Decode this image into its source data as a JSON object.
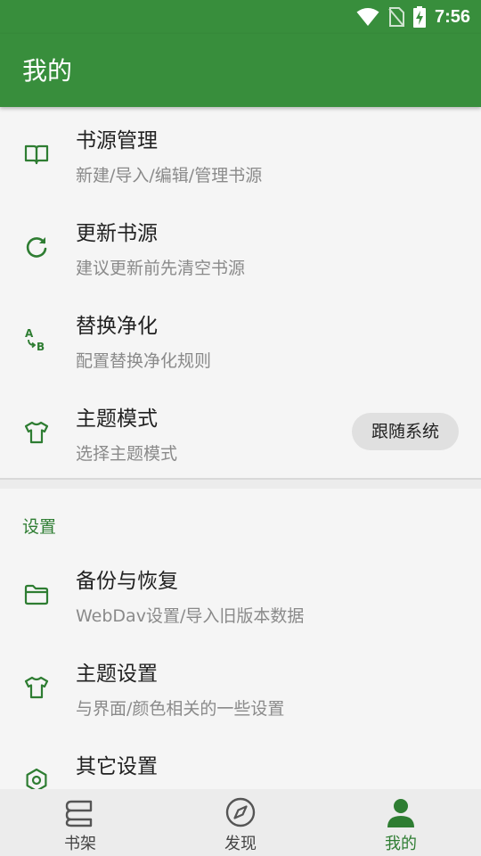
{
  "status_bar": {
    "time": "7:56",
    "icons": [
      "wifi-icon",
      "no-sim-icon",
      "battery-charging-icon"
    ]
  },
  "app_bar": {
    "title": "我的"
  },
  "colors": {
    "primary": "#388e3c",
    "accent": "#2e7d32"
  },
  "items": [
    {
      "icon": "book-open-icon",
      "title": "书源管理",
      "summary": "新建/导入/编辑/管理书源"
    },
    {
      "icon": "refresh-icon",
      "title": "更新书源",
      "summary": "建议更新前先清空书源"
    },
    {
      "icon": "replace-a-b-icon",
      "title": "替换净化",
      "summary": "配置替换净化规则"
    },
    {
      "icon": "tshirt-icon",
      "title": "主题模式",
      "summary": "选择主题模式",
      "value": "跟随系统"
    }
  ],
  "settings": {
    "header": "设置",
    "items": [
      {
        "icon": "folder-icon",
        "title": "备份与恢复",
        "summary": "WebDav设置/导入旧版本数据"
      },
      {
        "icon": "tshirt-icon",
        "title": "主题设置",
        "summary": "与界面/颜色相关的一些设置"
      },
      {
        "icon": "hexagon-nut-icon",
        "title": "其它设置"
      }
    ]
  },
  "bottom_nav": [
    {
      "icon": "bookshelf-icon",
      "label": "书架",
      "active": false
    },
    {
      "icon": "compass-icon",
      "label": "发现",
      "active": false
    },
    {
      "icon": "person-icon",
      "label": "我的",
      "active": true
    }
  ]
}
